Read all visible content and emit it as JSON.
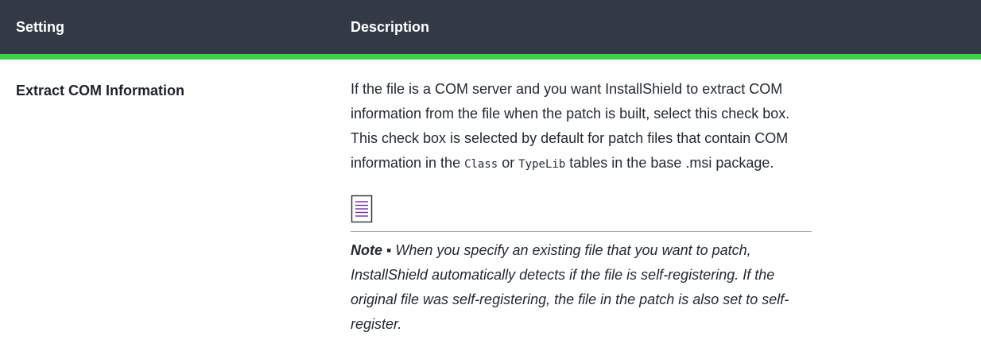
{
  "table": {
    "headers": {
      "setting": "Setting",
      "description": "Description"
    },
    "rows": [
      {
        "setting": "Extract COM Information",
        "description": {
          "lines": [
            "If the file is a COM server and you want InstallShield to extract COM",
            "information from the file when the patch is built, select this check box.",
            "This check box is selected by default for patch files that contain COM"
          ],
          "line4_prefix": "information in the ",
          "code1": "Class",
          "line4_middle": " or ",
          "code2": "TypeLib",
          "line4_suffix": " tables in the base .msi package."
        },
        "note": {
          "icon": "note-icon",
          "label": "Note",
          "separator": " ▪ ",
          "lines": [
            "When you specify an existing file that you want to patch,",
            "InstallShield automatically detects if the file is self-registering. If the",
            "original file was self-registering, the file in the patch is also set to self-",
            "register."
          ]
        }
      }
    ]
  },
  "colors": {
    "header_bg": "#323a45",
    "header_accent": "#3fd34a",
    "note_icon": "#7b2fa3"
  }
}
